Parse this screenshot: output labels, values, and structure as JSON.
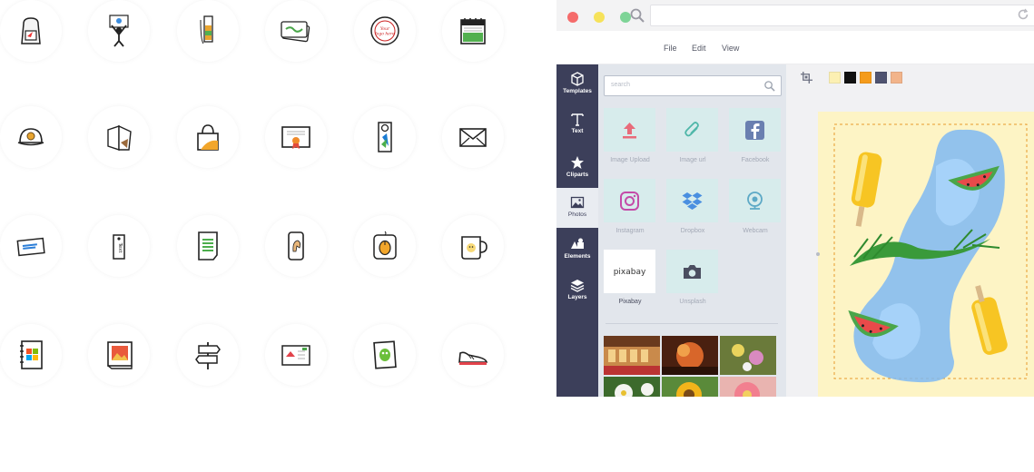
{
  "icon_grid": {
    "icons": [
      {
        "name": "backpack-icon"
      },
      {
        "name": "sign-holder-icon"
      },
      {
        "name": "bookmark-icon"
      },
      {
        "name": "business-card-icon"
      },
      {
        "name": "round-sticker-icon"
      },
      {
        "name": "calendar-icon"
      },
      {
        "name": "cap-icon"
      },
      {
        "name": "folder-icon"
      },
      {
        "name": "bag-icon"
      },
      {
        "name": "certificate-icon"
      },
      {
        "name": "door-hanger-icon"
      },
      {
        "name": "envelope-icon"
      },
      {
        "name": "ticket-icon"
      },
      {
        "name": "tag-icon"
      },
      {
        "name": "document-icon"
      },
      {
        "name": "phone-case-icon"
      },
      {
        "name": "mousepad-icon"
      },
      {
        "name": "mug-icon"
      },
      {
        "name": "notebook-icon"
      },
      {
        "name": "photo-book-icon"
      },
      {
        "name": "signpost-icon"
      },
      {
        "name": "postcard-icon"
      },
      {
        "name": "magnet-icon"
      },
      {
        "name": "shoe-icon"
      }
    ],
    "sticker_text": "Your logo here",
    "tag_text": "Text"
  },
  "browser": {
    "menu": [
      "File",
      "Edit",
      "View"
    ],
    "nav": [
      {
        "label": "Templates",
        "icon": "box-icon"
      },
      {
        "label": "Text",
        "icon": "text-icon"
      },
      {
        "label": "Cliparts",
        "icon": "star-icon"
      },
      {
        "label": "Photos",
        "icon": "photo-icon"
      },
      {
        "label": "Elements",
        "icon": "shapes-icon"
      },
      {
        "label": "Layers",
        "icon": "layers-icon"
      }
    ],
    "search": {
      "placeholder": "search"
    },
    "sources": [
      {
        "label": "Image Upload",
        "icon": "upload-icon"
      },
      {
        "label": "Image url",
        "icon": "paperclip-icon"
      },
      {
        "label": "Facebook",
        "icon": "facebook-icon"
      },
      {
        "label": "Instagram",
        "icon": "instagram-icon"
      },
      {
        "label": "Dropbox",
        "icon": "dropbox-icon"
      },
      {
        "label": "Webcam",
        "icon": "webcam-icon"
      },
      {
        "label": "Pixabay",
        "icon": "pixabay-logo"
      },
      {
        "label": "Unsplash",
        "icon": "camera-icon"
      }
    ],
    "pixabay_logo_text": "pixabay",
    "swatches": [
      "#fcf0b3",
      "#111111",
      "#f59b1b",
      "#4f5370",
      "#f2b48a"
    ]
  }
}
